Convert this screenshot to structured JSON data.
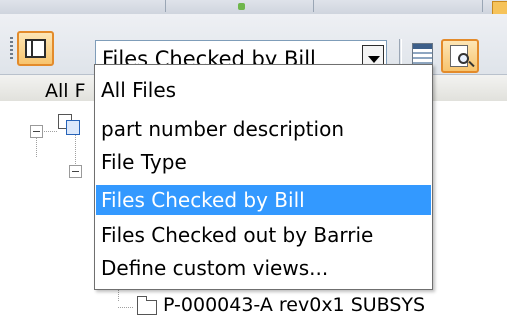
{
  "toolbar": {
    "view_selector_value": "Files Checked by Bill"
  },
  "column_header": {
    "label": "All F"
  },
  "dropdown": {
    "items": [
      {
        "label": "All Files"
      },
      {
        "label": "part number description"
      },
      {
        "label": "File Type"
      },
      {
        "label": "Files Checked by Bill",
        "selected": true
      },
      {
        "label": "Files Checked out by Barrie"
      },
      {
        "label": "Define custom views..."
      }
    ]
  },
  "tree": {
    "visible_node_label": "P-000043-A rev0x1 SUBSYS"
  },
  "icons": {
    "panel_toggle": "panel-layout-icon",
    "dropdown_arrow": "chevron-down-icon",
    "grid_view": "grid-view-icon",
    "search_view": "search-document-icon",
    "vault": "vault-icon",
    "folder": "folder-icon",
    "expander": "collapse-icon"
  },
  "colors": {
    "selection_highlight": "#3399ff",
    "accent_orange": "#e38b2b",
    "input_border": "#7f9db9"
  }
}
